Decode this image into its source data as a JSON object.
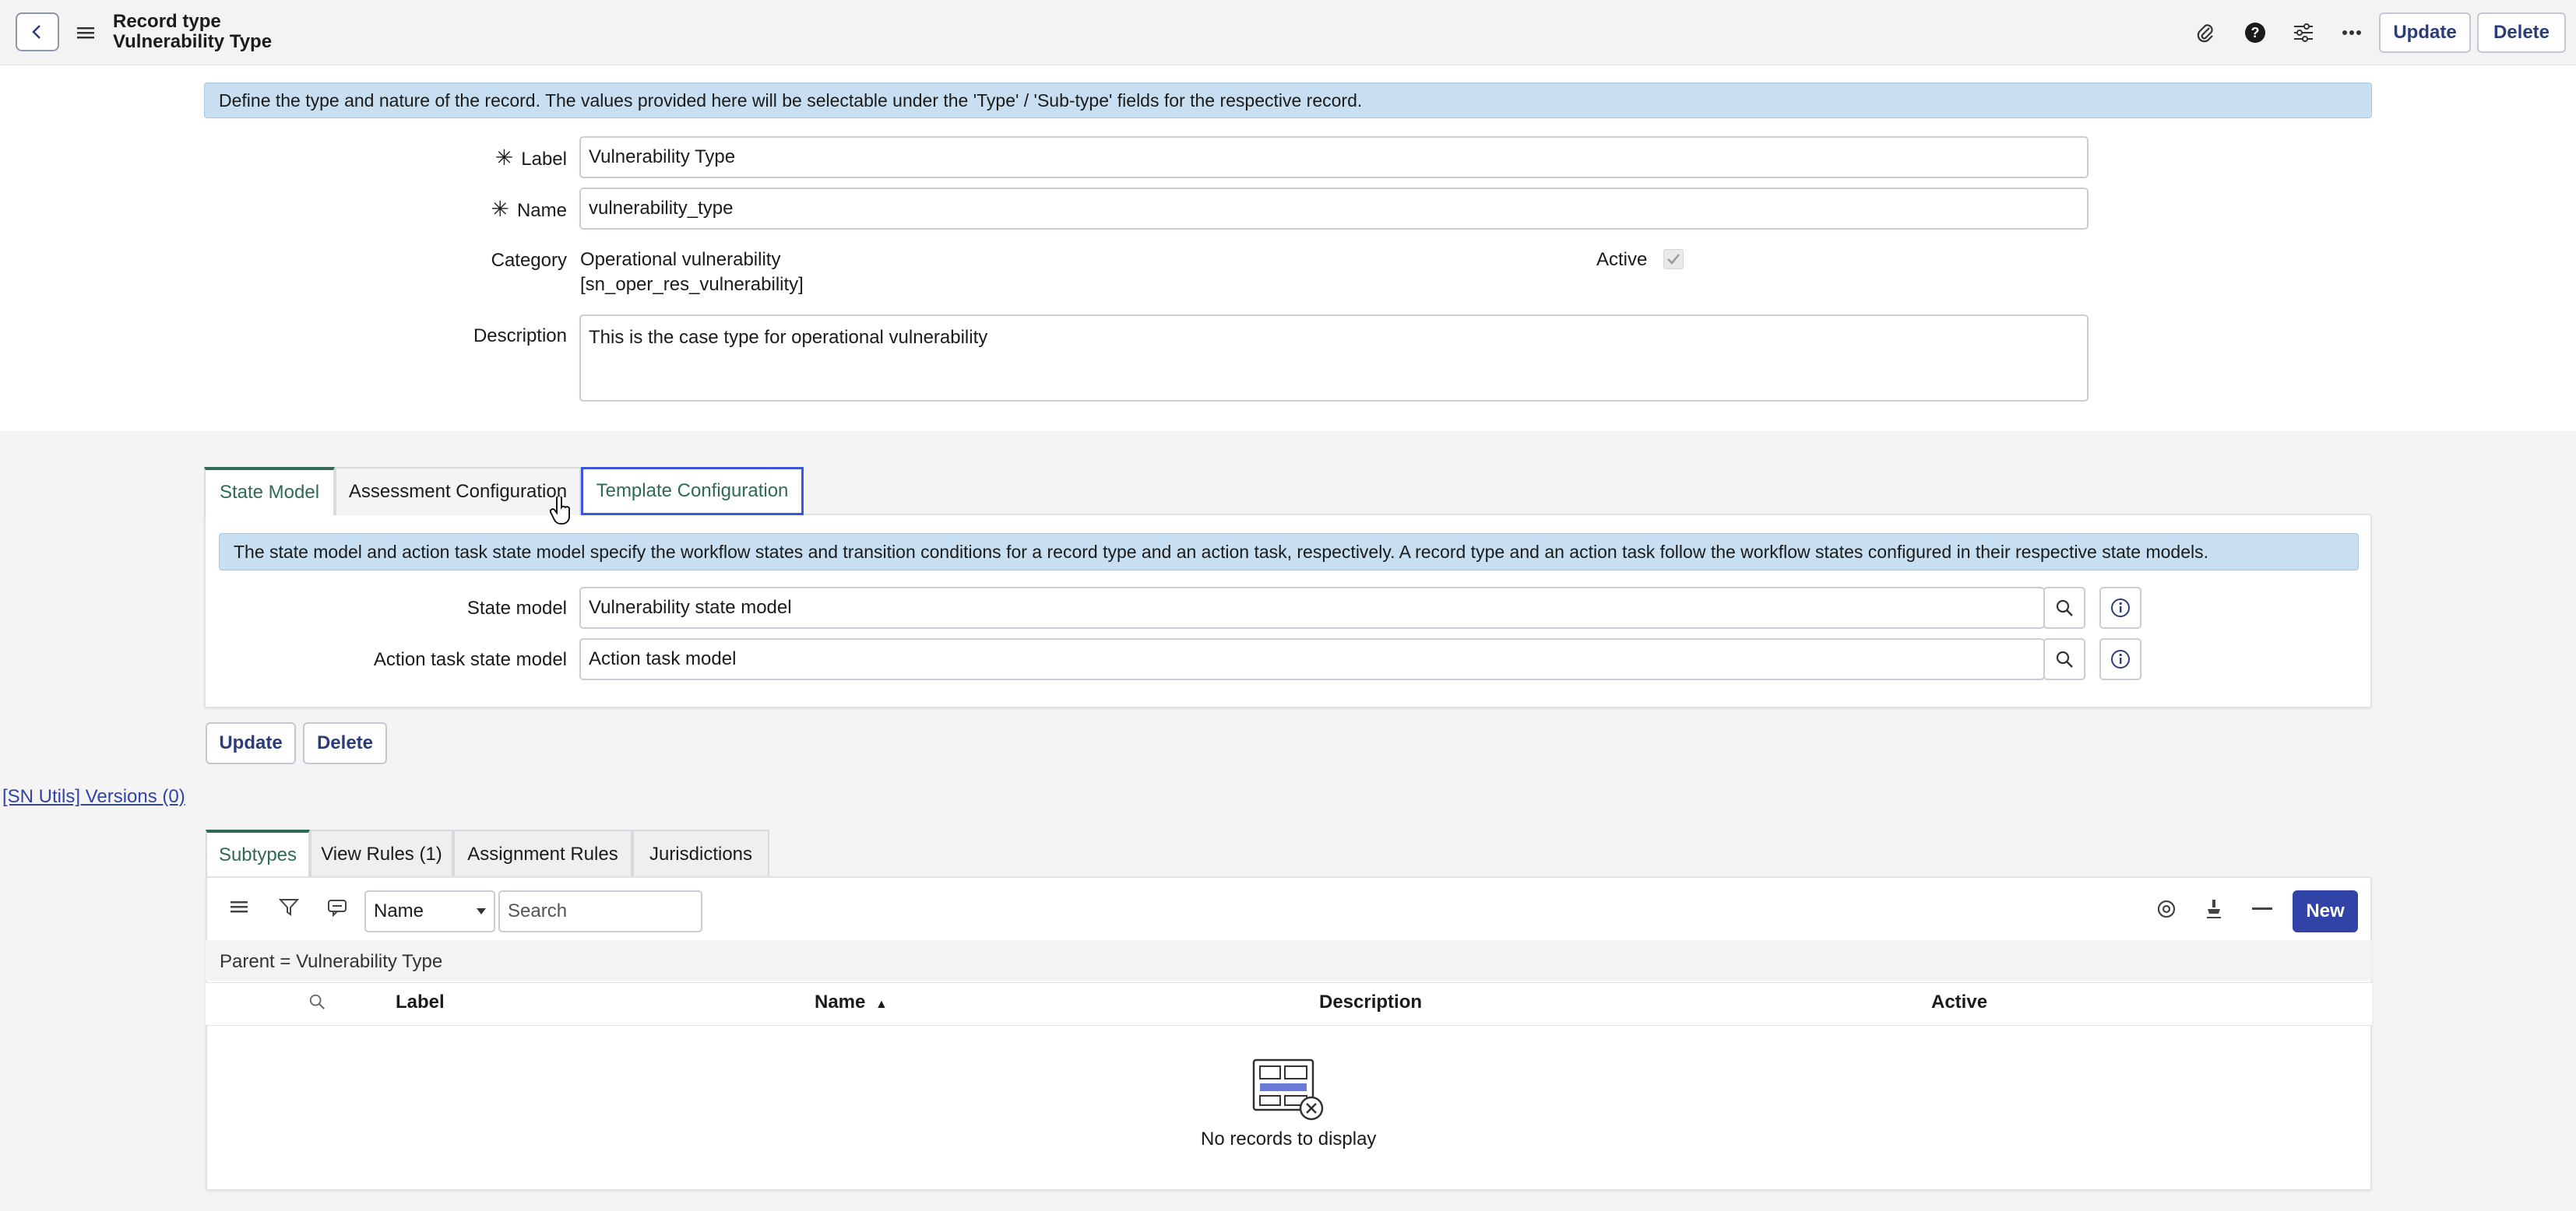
{
  "header": {
    "title_line1": "Record type",
    "title_line2": "Vulnerability Type",
    "update_label": "Update",
    "delete_label": "Delete",
    "icons": [
      "back-icon",
      "menu-icon",
      "paperclip-icon",
      "help-icon",
      "sliders-icon",
      "more-icon"
    ]
  },
  "form": {
    "info_text": "Define the type and nature of the record. The values provided here will be selectable under the 'Type' / 'Sub-type' fields for the respective record.",
    "required_mark": "✳",
    "label_label": "Label",
    "label_value": "Vulnerability Type",
    "name_label": "Name",
    "name_value": "vulnerability_type",
    "category_label": "Category",
    "category_value_line1": "Operational vulnerability",
    "category_value_line2": "[sn_oper_res_vulnerability]",
    "active_label": "Active",
    "active_checked": true,
    "description_label": "Description",
    "description_value": "This is the case type for operational vulnerability"
  },
  "section_tabs": {
    "tabs": [
      {
        "label": "State Model",
        "state": "active"
      },
      {
        "label": "Assessment Configuration",
        "state": "hover"
      },
      {
        "label": "Template Configuration",
        "state": "focused"
      }
    ],
    "info_text": "The state model and action task state model specify the workflow states and transition conditions for a record type and an action task, respectively. A record type and an action task follow the workflow states configured in their respective state models.",
    "state_model_label": "State model",
    "state_model_value": "Vulnerability state model",
    "action_task_label": "Action task state model",
    "action_task_value": "Action task model"
  },
  "bottom_buttons": {
    "update_label": "Update",
    "delete_label": "Delete"
  },
  "versions_link": "[SN Utils] Versions (0)",
  "related_lists": {
    "tabs": [
      {
        "label": "Subtypes",
        "active": true
      },
      {
        "label": "View Rules (1)",
        "active": false
      },
      {
        "label": "Assignment Rules",
        "active": false
      },
      {
        "label": "Jurisdictions",
        "active": false
      }
    ],
    "search_field_select": "Name",
    "search_placeholder": "Search",
    "new_label": "New",
    "filter_text": "Parent = Vulnerability Type",
    "columns": [
      "Label",
      "Name",
      "Description",
      "Active"
    ],
    "sort_indicator": "▲",
    "empty_text": "No records to display"
  },
  "colors": {
    "accent_green": "#2e6a54",
    "primary_blue": "#3243a8",
    "info_blue": "#c7dff0"
  }
}
